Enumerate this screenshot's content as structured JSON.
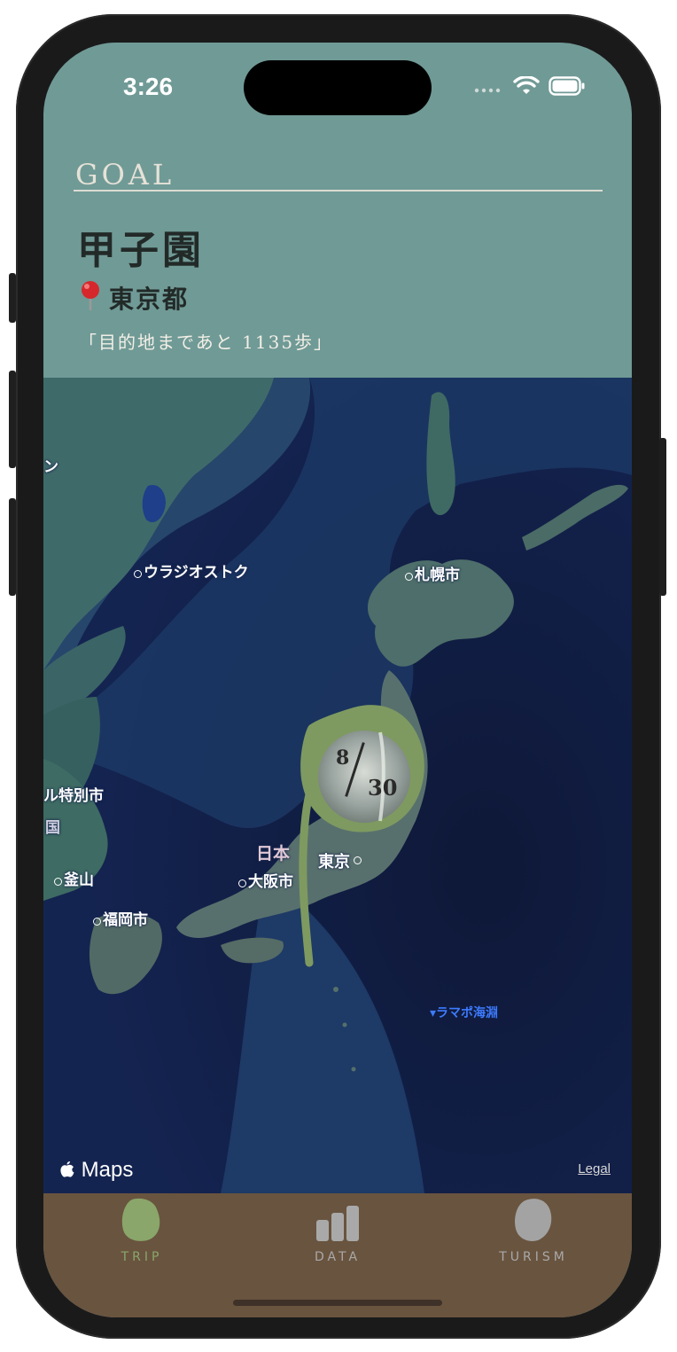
{
  "status": {
    "time": "3:26"
  },
  "header": {
    "goal_label": "GOAL",
    "destination": "甲子園",
    "prefecture": "東京都",
    "remaining_message": "「目的地まであと 1135歩」"
  },
  "map": {
    "labels": [
      "ウラジオストク",
      "札幌市",
      "ル特別市",
      "国",
      "釜山",
      "福岡市",
      "日本",
      "大阪市",
      "東京",
      "▾ラマポ海淵",
      "ン"
    ],
    "progress": {
      "numerator": "8",
      "denominator": "30",
      "fraction": 0.2667
    },
    "maps_logo": "Maps",
    "legal": "Legal"
  },
  "tabs": [
    {
      "label": "TRIP",
      "icon": "leaf-icon",
      "active": true
    },
    {
      "label": "DATA",
      "icon": "bar-chart-icon",
      "active": false
    },
    {
      "label": "TURISM",
      "icon": "stone-icon",
      "active": false
    }
  ],
  "colors": {
    "header_bg": "#709a96",
    "tab_bg": "#69543f",
    "active_tab": "#8aa66a",
    "inactive_tab": "#a9a9a9",
    "route": "#7e9a60"
  }
}
